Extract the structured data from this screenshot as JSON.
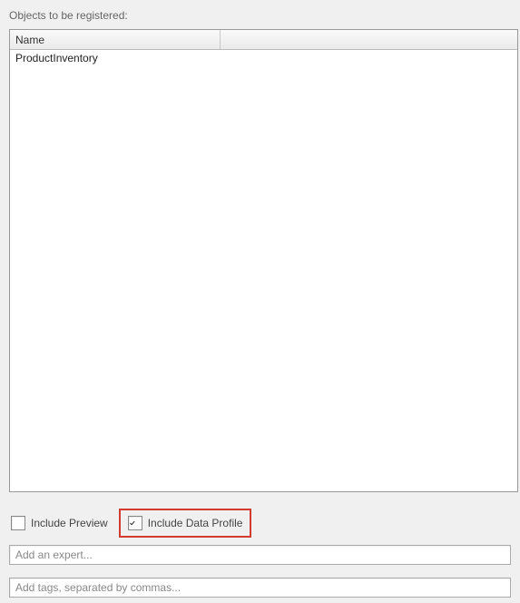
{
  "section": {
    "label": "Objects to be registered:"
  },
  "table": {
    "columns": {
      "name": "Name",
      "other": ""
    },
    "rows": [
      {
        "name": "ProductInventory"
      }
    ]
  },
  "options": {
    "include_preview": {
      "label": "Include Preview",
      "checked": false
    },
    "include_data_profile": {
      "label": "Include Data Profile",
      "checked": true
    }
  },
  "inputs": {
    "expert": {
      "placeholder": "Add an expert...",
      "value": ""
    },
    "tags": {
      "placeholder": "Add tags, separated by commas...",
      "value": ""
    }
  }
}
